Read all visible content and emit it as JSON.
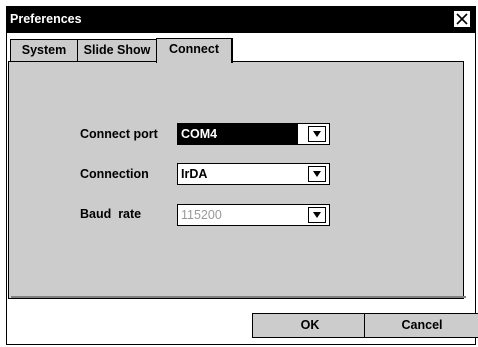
{
  "window": {
    "title": "Preferences"
  },
  "tabs": [
    {
      "label": "System"
    },
    {
      "label": "Slide Show"
    },
    {
      "label": "Connect"
    }
  ],
  "form": {
    "connect_port": {
      "label": "Connect port",
      "value": "COM4"
    },
    "connection": {
      "label": "Connection",
      "value": "IrDA"
    },
    "baud_rate": {
      "label": "Baud  rate",
      "value": "115200"
    }
  },
  "buttons": {
    "ok": "OK",
    "cancel": "Cancel"
  },
  "icons": {
    "close": "close-icon",
    "dropdown": "dropdown-arrow-icon"
  },
  "colors": {
    "titlebar": "#000000",
    "panel": "#cccccc",
    "selection": "#000000",
    "disabled_text": "#999999"
  }
}
